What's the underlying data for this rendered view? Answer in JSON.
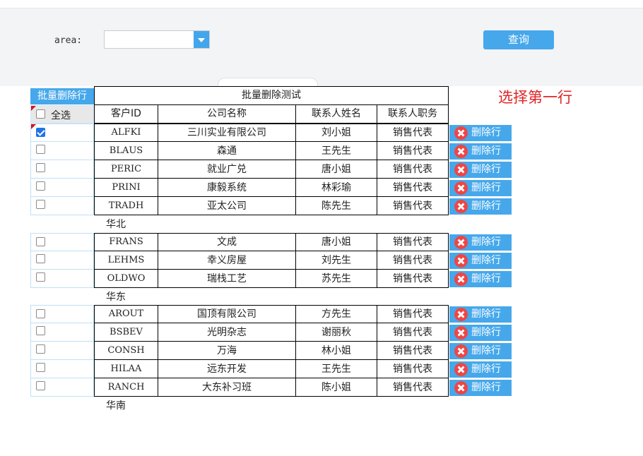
{
  "query": {
    "area_label": "area:",
    "area_value": "",
    "button_label": "查询"
  },
  "note": "选择第一行",
  "toolbar": {
    "batch_delete_label": "批量删除行"
  },
  "table": {
    "title": "批量删除测试",
    "select_all_label": "全选",
    "columns": [
      "客户ID",
      "公司名称",
      "联系人姓名",
      "联系人职务"
    ],
    "delete_label": "删除行",
    "groups": [
      {
        "region": "华北",
        "rows": [
          {
            "id": "ALFKI",
            "company": "三川实业有限公司",
            "contact": "刘小姐",
            "title": "销售代表",
            "checked": true
          },
          {
            "id": "BLAUS",
            "company": "森通",
            "contact": "王先生",
            "title": "销售代表",
            "checked": false
          },
          {
            "id": "PERIC",
            "company": "就业广兑",
            "contact": "唐小姐",
            "title": "销售代表",
            "checked": false
          },
          {
            "id": "PRINI",
            "company": "康毅系统",
            "contact": "林彩瑜",
            "title": "销售代表",
            "checked": false
          },
          {
            "id": "TRADH",
            "company": "亚太公司",
            "contact": "陈先生",
            "title": "销售代表",
            "checked": false
          }
        ]
      },
      {
        "region": "华东",
        "rows": [
          {
            "id": "FRANS",
            "company": "文成",
            "contact": "唐小姐",
            "title": "销售代表",
            "checked": false
          },
          {
            "id": "LEHMS",
            "company": "幸义房屋",
            "contact": "刘先生",
            "title": "销售代表",
            "checked": false
          },
          {
            "id": "OLDWO",
            "company": "瑞栈工艺",
            "contact": "苏先生",
            "title": "销售代表",
            "checked": false
          }
        ]
      },
      {
        "region": "华南",
        "rows": [
          {
            "id": "AROUT",
            "company": "国顶有限公司",
            "contact": "方先生",
            "title": "销售代表",
            "checked": false
          },
          {
            "id": "BSBEV",
            "company": "光明杂志",
            "contact": "谢丽秋",
            "title": "销售代表",
            "checked": false
          },
          {
            "id": "CONSH",
            "company": "万海",
            "contact": "林小姐",
            "title": "销售代表",
            "checked": false
          },
          {
            "id": "HILAA",
            "company": "远东开发",
            "contact": "王先生",
            "title": "销售代表",
            "checked": false
          },
          {
            "id": "RANCH",
            "company": "大东补习班",
            "contact": "陈小姐",
            "title": "销售代表",
            "checked": false
          }
        ]
      }
    ]
  },
  "colors": {
    "accent": "#46a8eb",
    "note": "#e02424",
    "delete_icon": "#ef4545"
  }
}
